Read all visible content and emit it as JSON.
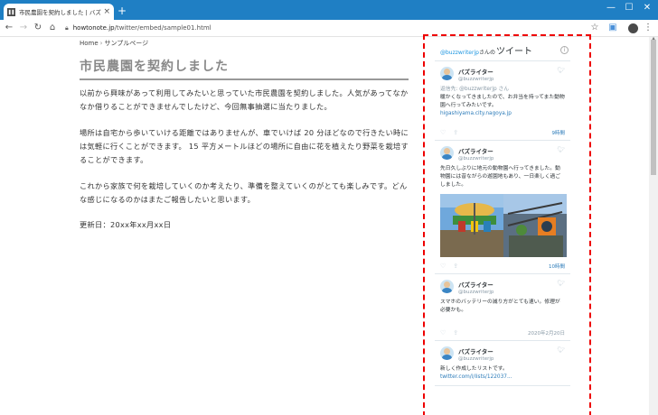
{
  "browser": {
    "tab_title": "市民農園を契約しました | バズブログ",
    "tab_close": "×",
    "new_tab": "+",
    "url_host": "howtonote.jp",
    "url_path": "/twitter/embed/sample01.html",
    "window_controls": [
      "—",
      "☐",
      "✕"
    ]
  },
  "page": {
    "breadcrumb": {
      "home": "Home",
      "separator": "›",
      "current": "サンプルページ"
    },
    "title": "市民農園を契約しました",
    "paragraphs": [
      "以前から興味があって利用してみたいと思っていた市民農園を契約しました。人気があってなかなか借りることができませんでしたけど、今回無事抽選に当たりました。",
      "場所は自宅から歩いていける距離ではありませんが、車でいけば 20 分ほどなので行きたい時には気軽に行くことができます。 15 平方メートルほどの場所に自由に花を植えたり野菜を栽培することができます。",
      "これから家族で何を栽培していくのか考えたり、準備を整えていくのがとても楽しみです。どんな感じになるのかはまたご報告したいと思います。",
      "更新日：20xx年xx月xx日"
    ]
  },
  "timeline": {
    "handle": "@buzzwriterjp",
    "handle_suffix": "さんの",
    "title": "ツイート",
    "info": "i",
    "tweets": [
      {
        "name": "バズライター",
        "handle": "@buzzwriterjp",
        "reply_to": "返信先: @buzzwriterjp さん",
        "text": "暖かくなってきましたので、お弁当を持ってまた動物園へ行ってみたいです。",
        "link": "higashiyama.city.nagoya.jp",
        "time": "9時間"
      },
      {
        "name": "バズライター",
        "handle": "@buzzwriterjp",
        "text": "先日久しぶりに地元の動物園へ行ってきました。動物園には昔ながらの遊園地もあり、一日楽しく過ごしました。",
        "time": "10時間"
      },
      {
        "name": "バズライター",
        "handle": "@buzzwriterjp",
        "text": "スマホのバッテリーの減り方がとても速い。修理が必要かも。",
        "time": "2020年2月20日"
      },
      {
        "name": "バズライター",
        "handle": "@buzzwriterjp",
        "text": "新しく作成したリストです。",
        "link": "twitter.com/i/lists/122037..."
      }
    ]
  },
  "colors": {
    "titlebar": "#1f7fc4",
    "highlight": "#ee0000",
    "twitter_link": "#2b7bb9",
    "title_gray": "#888888"
  }
}
